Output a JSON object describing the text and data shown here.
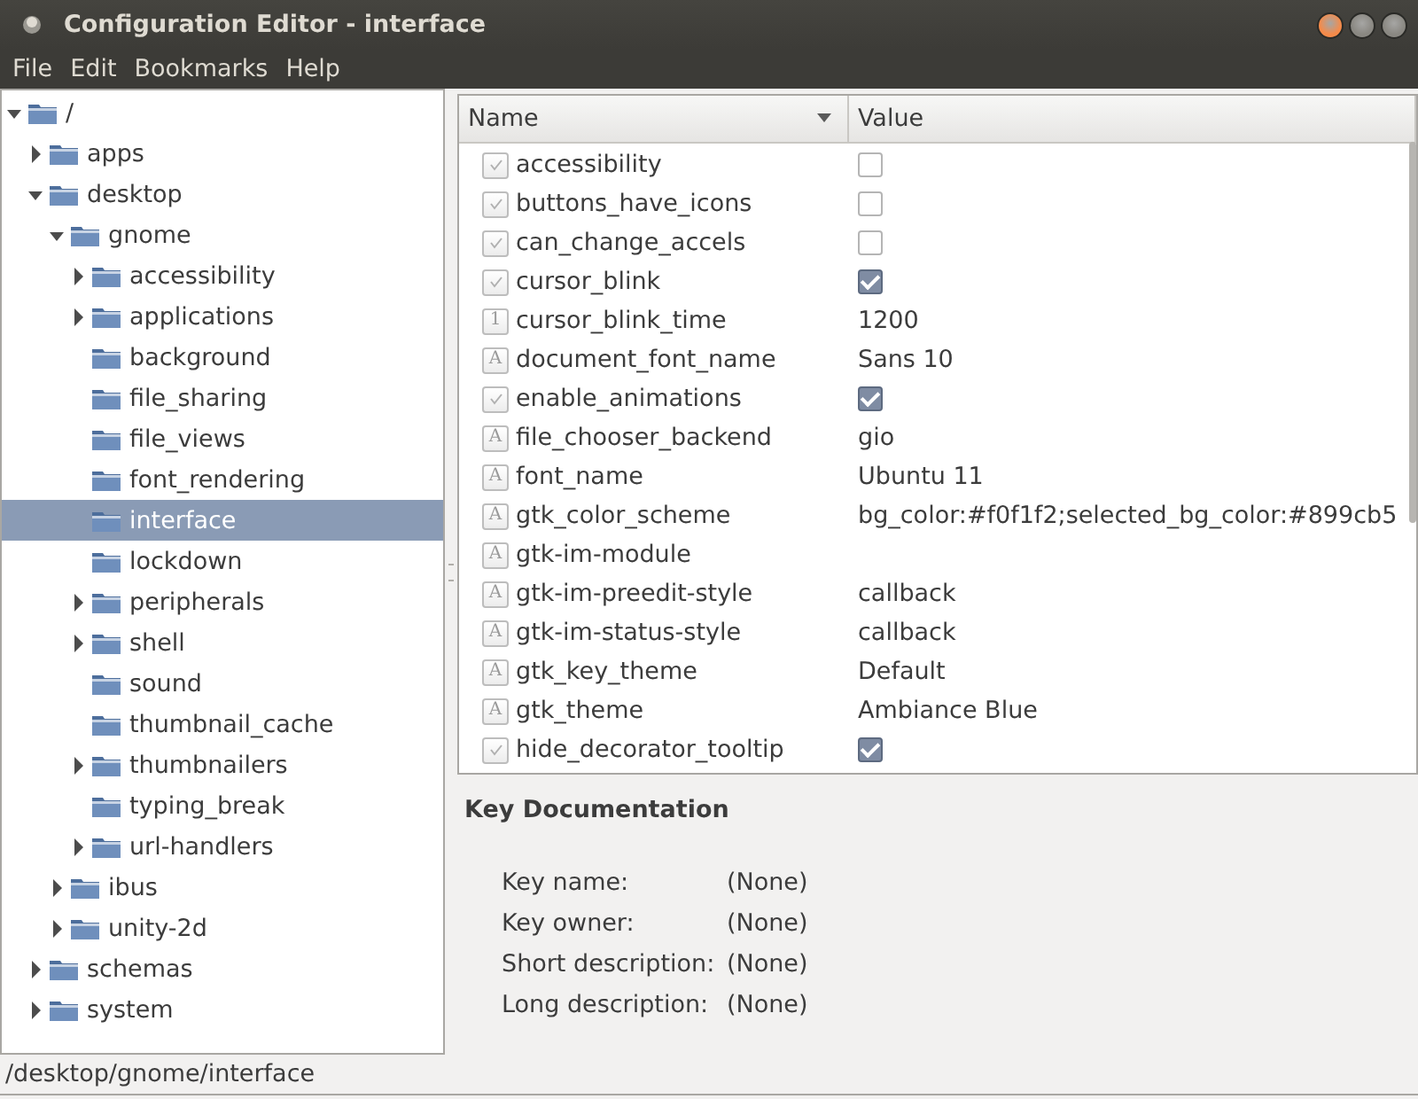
{
  "window": {
    "title": "Configuration Editor - interface"
  },
  "menu": [
    "File",
    "Edit",
    "Bookmarks",
    "Help"
  ],
  "tree": [
    {
      "label": "/",
      "kind": "branch",
      "expanded": true,
      "selected": false,
      "children": [
        {
          "label": "apps",
          "kind": "branch",
          "expanded": false,
          "selected": false
        },
        {
          "label": "desktop",
          "kind": "branch",
          "expanded": true,
          "selected": false,
          "children": [
            {
              "label": "gnome",
              "kind": "branch",
              "expanded": true,
              "selected": false,
              "children": [
                {
                  "label": "accessibility",
                  "kind": "branch",
                  "expanded": false,
                  "selected": false
                },
                {
                  "label": "applications",
                  "kind": "branch",
                  "expanded": false,
                  "selected": false
                },
                {
                  "label": "background",
                  "kind": "leaf",
                  "selected": false
                },
                {
                  "label": "file_sharing",
                  "kind": "leaf",
                  "selected": false
                },
                {
                  "label": "file_views",
                  "kind": "leaf",
                  "selected": false
                },
                {
                  "label": "font_rendering",
                  "kind": "leaf",
                  "selected": false
                },
                {
                  "label": "interface",
                  "kind": "leaf",
                  "selected": true
                },
                {
                  "label": "lockdown",
                  "kind": "leaf",
                  "selected": false
                },
                {
                  "label": "peripherals",
                  "kind": "branch",
                  "expanded": false,
                  "selected": false
                },
                {
                  "label": "shell",
                  "kind": "branch",
                  "expanded": false,
                  "selected": false
                },
                {
                  "label": "sound",
                  "kind": "leaf",
                  "selected": false
                },
                {
                  "label": "thumbnail_cache",
                  "kind": "leaf",
                  "selected": false
                },
                {
                  "label": "thumbnailers",
                  "kind": "branch",
                  "expanded": false,
                  "selected": false
                },
                {
                  "label": "typing_break",
                  "kind": "leaf",
                  "selected": false
                },
                {
                  "label": "url-handlers",
                  "kind": "branch",
                  "expanded": false,
                  "selected": false
                }
              ]
            },
            {
              "label": "ibus",
              "kind": "branch",
              "expanded": false,
              "selected": false
            },
            {
              "label": "unity-2d",
              "kind": "branch",
              "expanded": false,
              "selected": false
            }
          ]
        },
        {
          "label": "schemas",
          "kind": "branch",
          "expanded": false,
          "selected": false
        },
        {
          "label": "system",
          "kind": "branch",
          "expanded": false,
          "selected": false
        }
      ]
    }
  ],
  "keys": {
    "columns": [
      {
        "label": "Name",
        "sorted": true
      },
      {
        "label": "Value",
        "sorted": false
      }
    ],
    "rows": [
      {
        "kind": "bool",
        "name": "accessibility",
        "checked": false
      },
      {
        "kind": "bool",
        "name": "buttons_have_icons",
        "checked": false
      },
      {
        "kind": "bool",
        "name": "can_change_accels",
        "checked": false
      },
      {
        "kind": "bool",
        "name": "cursor_blink",
        "checked": true
      },
      {
        "kind": "int",
        "glyph": "1",
        "name": "cursor_blink_time",
        "value": "1200"
      },
      {
        "kind": "string",
        "glyph": "A",
        "name": "document_font_name",
        "value": "Sans 10"
      },
      {
        "kind": "bool",
        "name": "enable_animations",
        "checked": true
      },
      {
        "kind": "string",
        "glyph": "A",
        "name": "file_chooser_backend",
        "value": "gio"
      },
      {
        "kind": "string",
        "glyph": "A",
        "name": "font_name",
        "value": "Ubuntu 11"
      },
      {
        "kind": "string",
        "glyph": "A",
        "name": "gtk_color_scheme",
        "value": "bg_color:#f0f1f2;selected_bg_color:#899cb5"
      },
      {
        "kind": "string",
        "glyph": "A",
        "name": "gtk-im-module"
      },
      {
        "kind": "string",
        "glyph": "A",
        "name": "gtk-im-preedit-style",
        "value": "callback"
      },
      {
        "kind": "string",
        "glyph": "A",
        "name": "gtk-im-status-style",
        "value": "callback"
      },
      {
        "kind": "string",
        "glyph": "A",
        "name": "gtk_key_theme",
        "value": "Default"
      },
      {
        "kind": "string",
        "glyph": "A",
        "name": "gtk_theme",
        "value": "Ambiance Blue"
      },
      {
        "kind": "bool",
        "name": "hide_decorator_tooltip",
        "checked": true
      }
    ]
  },
  "documentation": {
    "title": "Key Documentation",
    "fields": [
      {
        "label": "Key name:",
        "value": "(None)"
      },
      {
        "label": "Key owner:",
        "value": "(None)"
      },
      {
        "label": "Short description:",
        "value": "(None)"
      },
      {
        "label": "Long description:",
        "value": "(None)"
      }
    ]
  },
  "status_bar": "/desktop/gnome/interface"
}
